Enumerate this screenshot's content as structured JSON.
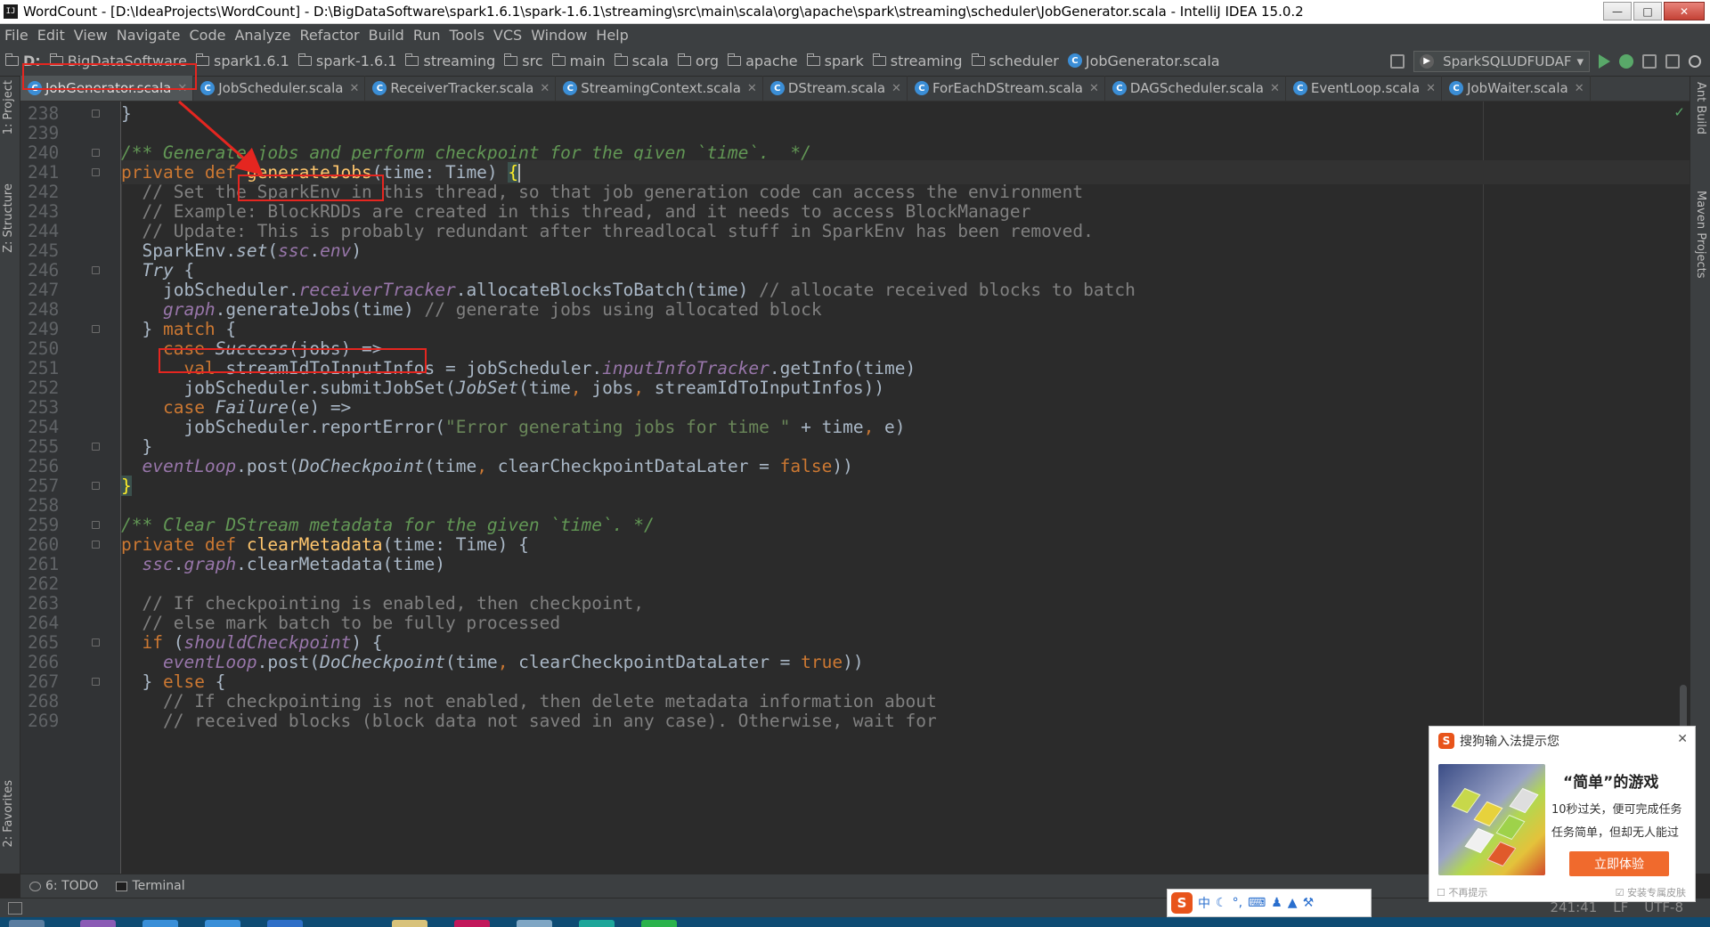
{
  "window": {
    "title": "WordCount - [D:\\IdeaProjects\\WordCount] - D:\\BigDataSoftware\\spark1.6.1\\spark-1.6.1\\streaming\\src\\main\\scala\\org\\apache\\spark\\streaming\\scheduler\\JobGenerator.scala - IntelliJ IDEA 15.0.2"
  },
  "menu": [
    "File",
    "Edit",
    "View",
    "Navigate",
    "Code",
    "Analyze",
    "Refactor",
    "Build",
    "Run",
    "Tools",
    "VCS",
    "Window",
    "Help"
  ],
  "breadcrumbs": [
    "D:",
    "BigDataSoftware",
    "spark1.6.1",
    "spark-1.6.1",
    "streaming",
    "src",
    "main",
    "scala",
    "org",
    "apache",
    "spark",
    "streaming",
    "scheduler",
    "JobGenerator.scala"
  ],
  "run_config": "SparkSQLUDFUDAF",
  "tabs": [
    "JobGenerator.scala",
    "JobScheduler.scala",
    "ReceiverTracker.scala",
    "StreamingContext.scala",
    "DStream.scala",
    "ForEachDStream.scala",
    "DAGScheduler.scala",
    "EventLoop.scala",
    "JobWaiter.scala"
  ],
  "left_tools": [
    "1: Project",
    "Z: Structure",
    "2: Favorites"
  ],
  "right_tools": [
    "Ant Build",
    "Maven Projects"
  ],
  "bottom_tools": [
    "6: TODO",
    "Terminal"
  ],
  "line_numbers": [
    "238",
    "239",
    "240",
    "241",
    "242",
    "243",
    "244",
    "245",
    "246",
    "247",
    "248",
    "249",
    "250",
    "251",
    "252",
    "253",
    "254",
    "255",
    "256",
    "257",
    "258",
    "259",
    "260",
    "261",
    "262",
    "263",
    "264",
    "265",
    "266",
    "267",
    "268",
    "269"
  ],
  "status": {
    "position": "241:41",
    "line_sep": "LF",
    "encoding": "UTF-8"
  },
  "ime_popup": {
    "header": "搜狗输入法提示您",
    "title": "“简单”的游戏",
    "desc1": "10秒过关，便可完成任务",
    "desc2": "任务简单，但却无人能过",
    "button": "立即体验",
    "foot_left": "不再提示",
    "foot_right": "安装专属皮肤"
  },
  "ime_bar": {
    "logo": "S",
    "mode": "中"
  },
  "colors": {
    "keyword": "#cc7832",
    "comment": "#808080",
    "doc": "#629755",
    "function": "#ffc66d",
    "field": "#9876aa",
    "string": "#6a8759",
    "highlight": "#e52620"
  }
}
